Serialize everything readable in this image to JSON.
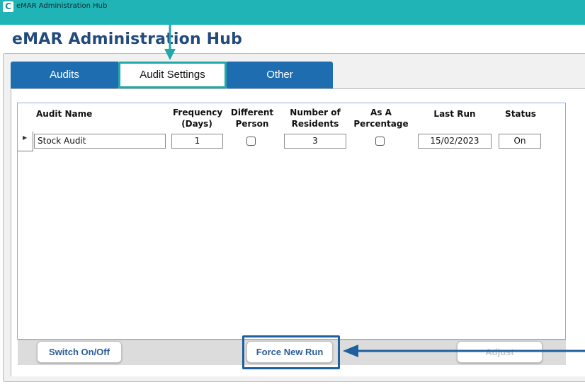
{
  "window": {
    "title": "eMAR Administration Hub",
    "icon": "C"
  },
  "header": {
    "title": "eMAR Administration Hub"
  },
  "tabs": [
    {
      "label": "Audits",
      "active": false
    },
    {
      "label": "Audit Settings",
      "active": true
    },
    {
      "label": "Other",
      "active": false
    }
  ],
  "grid": {
    "headers": {
      "audit_name": "Audit Name",
      "frequency": "Frequency (Days)",
      "different_person": "Different Person",
      "number_of_residents": "Number of Residents",
      "as_a_percentage": "As A Percentage",
      "last_run": "Last Run",
      "status": "Status"
    },
    "rows": [
      {
        "audit_name": "Stock Audit",
        "frequency": "1",
        "different_person": false,
        "number_of_residents": "3",
        "as_a_percentage": false,
        "last_run": "15/02/2023",
        "status": "On"
      }
    ]
  },
  "buttons": {
    "switch": "Switch On/Off",
    "force": "Force New Run",
    "adjust": "Adjust"
  },
  "colors": {
    "titlebar": "#20b4b6",
    "tab_active_border": "#20a9a8",
    "tab_inactive": "#1e6db0",
    "title_text": "#234a7c",
    "highlight": "#1e5f9e",
    "arrow_teal": "#20a9a8",
    "arrow_blue": "#1e5f9e"
  }
}
